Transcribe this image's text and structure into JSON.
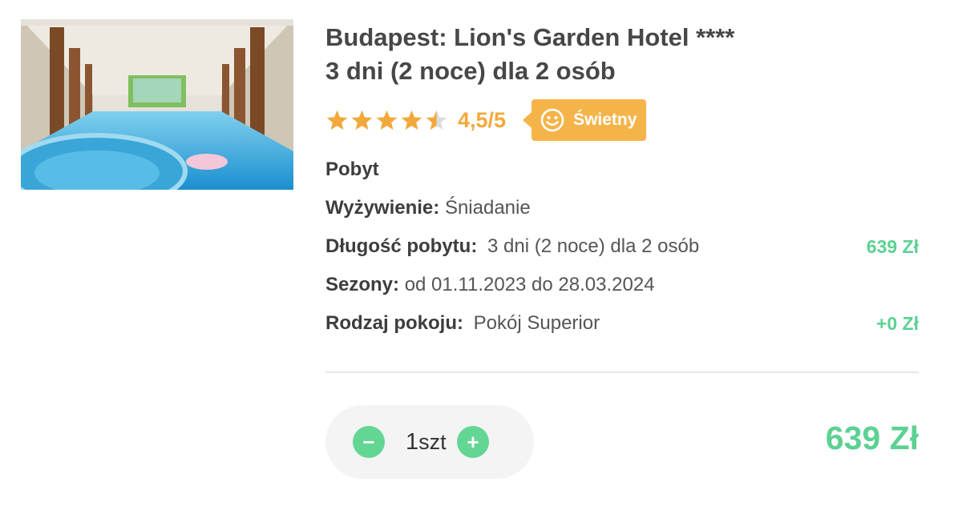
{
  "hotel": {
    "image_alt": "Hotel indoor swimming pool",
    "title_line1": "Budapest: Lion's Garden Hotel ****",
    "title_line2": "3 dni (2 noce) dla 2 osób"
  },
  "rating": {
    "stars_value": 4.5,
    "stars_max": 5,
    "score_text": "4,5/5",
    "badge_label": "Świetny",
    "badge_icon": "smiley-face-icon",
    "star_color": "#f2a93b",
    "badge_color": "#f5b44a"
  },
  "details": {
    "section_title": "Pobyt",
    "board_label": "Wyżywienie:",
    "board_value": "Śniadanie",
    "length_label": "Długość pobytu:",
    "length_value": "3 dni (2 noce) dla 2 osób",
    "length_price": "639 Zł",
    "seasons_label": "Sezony:",
    "seasons_value": "od 01.11.2023 do 28.03.2024",
    "room_label": "Rodzaj pokoju:",
    "room_value": "Pokój Superior",
    "room_price": "+0 Zł"
  },
  "quantity": {
    "value": "1",
    "unit": "szt",
    "minus_label": "−",
    "plus_label": "+",
    "accent_color": "#63d694"
  },
  "total": {
    "price": "639 Zł"
  }
}
